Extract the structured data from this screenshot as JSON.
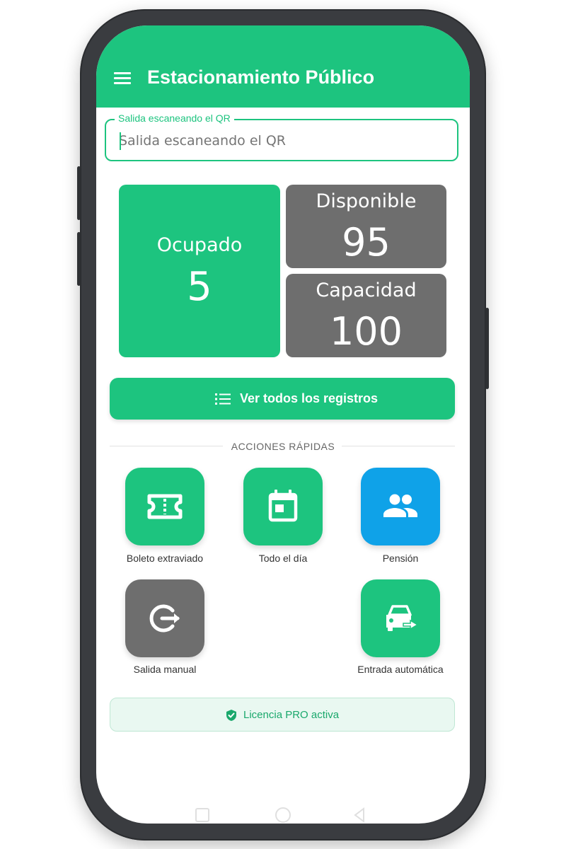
{
  "app": {
    "title": "Estacionamiento Público",
    "accent_color": "#1dc47f",
    "menu_icon": "hamburger-menu-icon"
  },
  "qr_field": {
    "label": "Salida escaneando el QR",
    "placeholder": "Salida escaneando el QR"
  },
  "stats": {
    "occupied": {
      "label": "Ocupado",
      "value": "5",
      "color": "#1dc47f"
    },
    "available": {
      "label": "Disponible",
      "value": "95",
      "color": "#6e6e6e"
    },
    "capacity": {
      "label": "Capacidad",
      "value": "100",
      "color": "#6e6e6e"
    }
  },
  "records_button": {
    "label": "Ver todos los registros",
    "icon": "list-icon"
  },
  "quick_actions": {
    "title": "ACCIONES RÁPIDAS",
    "items": [
      {
        "label": "Boleto extraviado",
        "icon": "ticket-icon",
        "color": "#1dc47f"
      },
      {
        "label": "Todo el día",
        "icon": "calendar-icon",
        "color": "#1dc47f"
      },
      {
        "label": "Pensión",
        "icon": "group-icon",
        "color": "#0fa2e8"
      },
      {
        "label": "Salida manual",
        "icon": "exit-icon",
        "color": "#6e6e6e"
      },
      {
        "label": "Entrada automática",
        "icon": "car-enter-icon",
        "color": "#1dc47f"
      }
    ]
  },
  "license": {
    "text": "Licencia PRO activa",
    "icon": "verified-shield-icon"
  }
}
